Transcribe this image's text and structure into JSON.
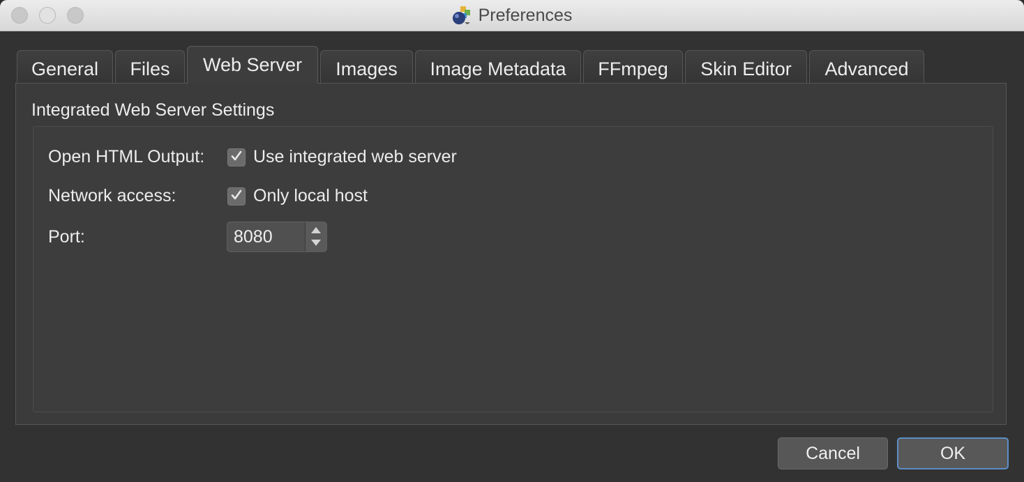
{
  "window": {
    "title": "Preferences",
    "app_icon": "app-logo-icon"
  },
  "tabs": [
    {
      "label": "General",
      "active": false
    },
    {
      "label": "Files",
      "active": false
    },
    {
      "label": "Web Server",
      "active": true
    },
    {
      "label": "Images",
      "active": false
    },
    {
      "label": "Image Metadata",
      "active": false
    },
    {
      "label": "FFmpeg",
      "active": false
    },
    {
      "label": "Skin Editor",
      "active": false
    },
    {
      "label": "Advanced",
      "active": false
    }
  ],
  "section": {
    "title": "Integrated Web Server Settings"
  },
  "settings": {
    "open_html_output": {
      "label": "Open HTML Output:",
      "checkbox_label": "Use integrated web server",
      "checked": true
    },
    "network_access": {
      "label": "Network access:",
      "checkbox_label": "Only local host",
      "checked": true
    },
    "port": {
      "label": "Port:",
      "value": "8080"
    }
  },
  "buttons": {
    "cancel": "Cancel",
    "ok": "OK"
  },
  "colors": {
    "focus_ring": "#5d8ec8",
    "background": "#323232",
    "pane": "#3b3b3b",
    "text": "#ededed"
  }
}
